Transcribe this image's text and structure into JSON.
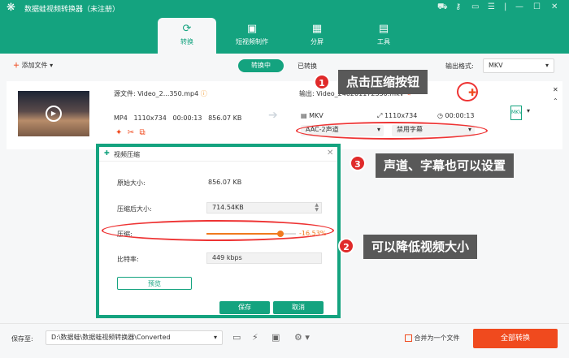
{
  "app": {
    "title": "数据蛙视频转换器（未注册）"
  },
  "tabs": [
    {
      "label": "转换",
      "icon": "convert-icon"
    },
    {
      "label": "短视频制作",
      "icon": "short-video-icon"
    },
    {
      "label": "分屏",
      "icon": "split-screen-icon"
    },
    {
      "label": "工具",
      "icon": "toolbox-icon"
    }
  ],
  "toolbar": {
    "add_file": "添加文件",
    "converting": "转换中",
    "converted": "已转换",
    "output_format_label": "输出格式:",
    "output_format_value": "MKV"
  },
  "file": {
    "source_label": "源文件:",
    "source_name": "Video_2...350.mp4",
    "output_label": "输出:",
    "output_name": "Video_240201172350.mkv",
    "format": "MP4",
    "resolution": "1110x734",
    "duration": "00:00:13",
    "size": "856.07 KB",
    "out_format": "MKV",
    "out_resolution": "1110x734",
    "out_duration": "00:00:13",
    "audio": "AAC-2声道",
    "subtitle": "禁用字幕"
  },
  "dialog": {
    "title": "视频压缩",
    "original_size_label": "原始大小:",
    "original_size_value": "856.07 KB",
    "compressed_size_label": "压缩后大小:",
    "compressed_size_value": "714.54KB",
    "compress_label": "压缩:",
    "compress_percent": "-16.53%",
    "compress_level": 0.83,
    "bitrate_label": "比特率:",
    "bitrate_value": "449 kbps",
    "preview": "预览",
    "save": "保存",
    "cancel": "取消"
  },
  "callouts": {
    "c1_num": "1",
    "c1": "点击压缩按钮",
    "c2_num": "2",
    "c2": "可以降低视频大小",
    "c3_num": "3",
    "c3": "声道、字幕也可以设置"
  },
  "bottom": {
    "save_to_label": "保存至:",
    "path": "D:\\数据蛙\\数据蛙视频转换器\\Converted",
    "merge_label": "合并为一个文件",
    "convert_all": "全部转换"
  },
  "colors": {
    "brand": "#14a37f",
    "accent": "#f04a1e",
    "annotation": "#e02a2a"
  }
}
